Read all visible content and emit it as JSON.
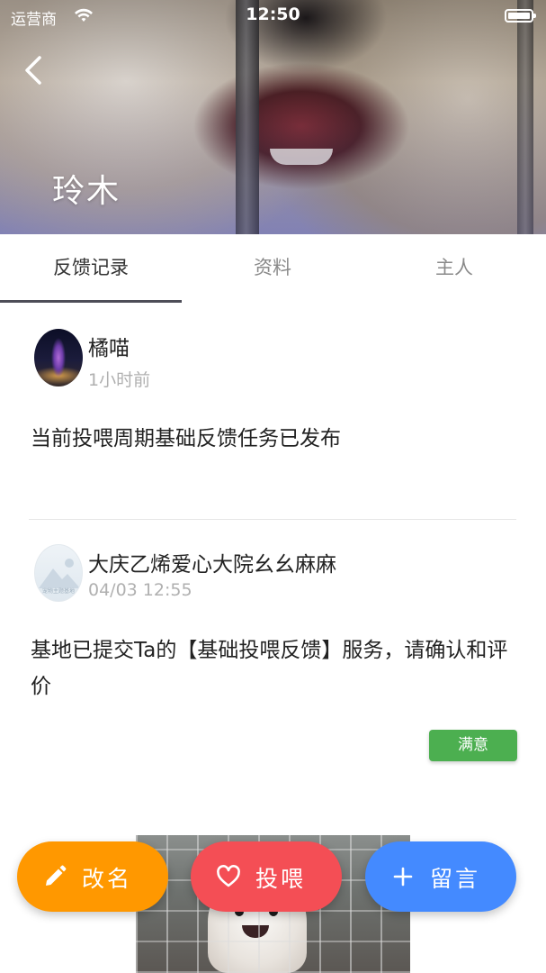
{
  "status_bar": {
    "carrier": "运营商",
    "time": "12:50"
  },
  "header": {
    "pet_name": "玲木"
  },
  "tabs": [
    {
      "label": "反馈记录",
      "active": true
    },
    {
      "label": "资料",
      "active": false
    },
    {
      "label": "主人",
      "active": false
    }
  ],
  "feed": [
    {
      "author": "橘喵",
      "time": "1小时前",
      "content": "当前投喂周期基础反馈任务已发布"
    },
    {
      "author": "大庆乙烯爱心大院幺幺麻麻",
      "time": "04/03 12:55",
      "avatar_caption": "宠物主题基地",
      "content": "基地已提交Ta的【基础投喂反馈】服务，请确认和评价",
      "badge": "满意"
    }
  ],
  "actions": {
    "rename": "改名",
    "feed": "投喂",
    "message": "留言"
  },
  "colors": {
    "rename": "#ff9800",
    "feed": "#f44e55",
    "message": "#448aff",
    "badge": "#4caf50",
    "tab_indicator": "#4d4d57"
  }
}
